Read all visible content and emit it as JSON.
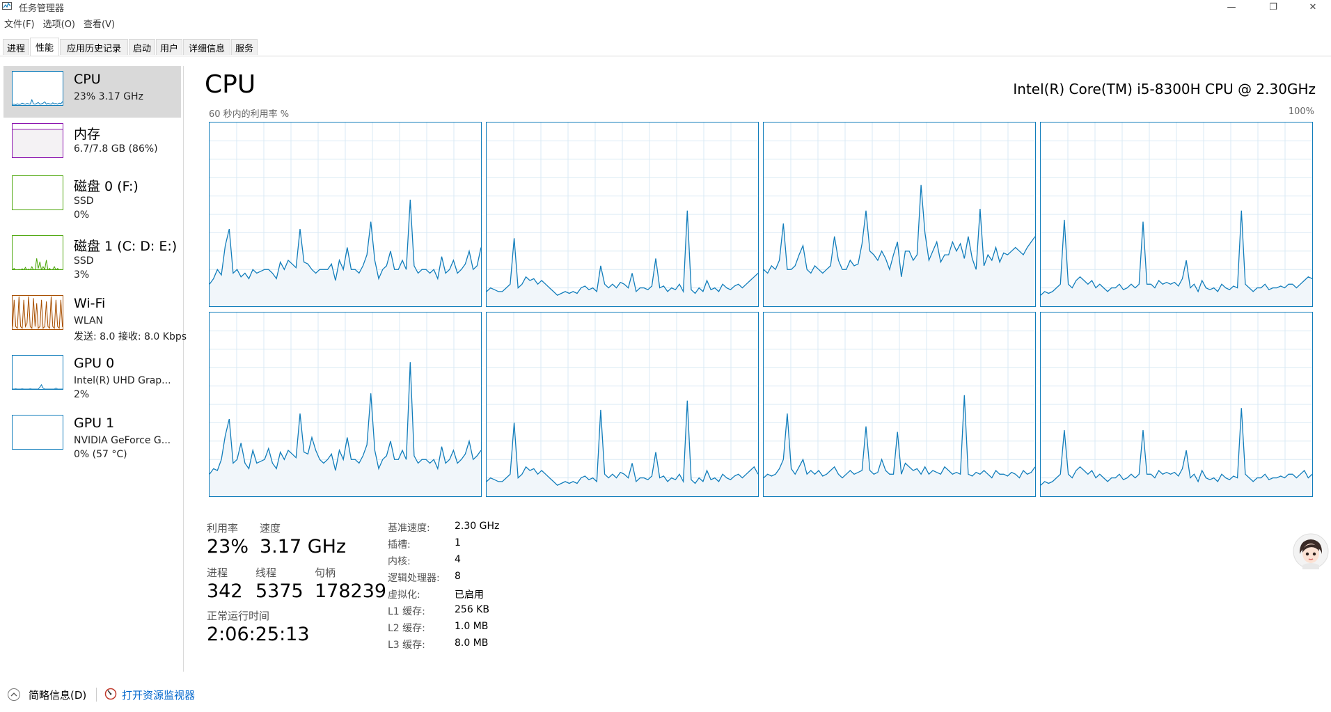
{
  "window": {
    "title": "任务管理器",
    "controls": {
      "minimize": "—",
      "maximize": "❐",
      "close": "✕"
    }
  },
  "menu": [
    "文件(F)",
    "选项(O)",
    "查看(V)"
  ],
  "tabs": [
    "进程",
    "性能",
    "应用历史记录",
    "启动",
    "用户",
    "详细信息",
    "服务"
  ],
  "active_tab": "性能",
  "sidebar": [
    {
      "title": "CPU",
      "line1": "23%  3.17 GHz",
      "line2": "",
      "color": "#117dbb",
      "fill": "#f1f6fa",
      "active": true,
      "graph": [
        0.04,
        0.05,
        0.03,
        0.06,
        0.04,
        0.05,
        0.08,
        0.06,
        0.05,
        0.07,
        0.06,
        0.05,
        0.18,
        0.06,
        0.05,
        0.07,
        0.1,
        0.05,
        0.06,
        0.08,
        0.12,
        0.05,
        0.07,
        0.06,
        0.05,
        0.09,
        0.06,
        0.07,
        0.05,
        0.08,
        0.06,
        0.12,
        0.05
      ]
    },
    {
      "title": "内存",
      "line1": "6.7/7.8 GB (86%)",
      "line2": "",
      "color": "#8b12ae",
      "fill": "#f4f2f4",
      "active": false,
      "graph": [
        0.86,
        0.86,
        0.86,
        0.86,
        0.86,
        0.86,
        0.86,
        0.86,
        0.86,
        0.86,
        0.86,
        0.86,
        0.86,
        0.86,
        0.86,
        0.86,
        0.86,
        0.86,
        0.86,
        0.86,
        0.86,
        0.86,
        0.86,
        0.86,
        0.86,
        0.86,
        0.86,
        0.86,
        0.86,
        0.86,
        0.86,
        0.86,
        0.86
      ]
    },
    {
      "title": "磁盘 0 (F:)",
      "line1": "SSD",
      "line2": "0%",
      "color": "#4da60c",
      "fill": "#eff7e9",
      "active": false,
      "graph": [
        0,
        0,
        0,
        0,
        0,
        0,
        0,
        0,
        0,
        0,
        0,
        0,
        0,
        0,
        0,
        0,
        0,
        0,
        0,
        0,
        0,
        0,
        0,
        0,
        0,
        0,
        0,
        0,
        0,
        0,
        0,
        0,
        0
      ]
    },
    {
      "title": "磁盘 1 (C: D: E:)",
      "line1": "SSD",
      "line2": "3%",
      "color": "#4da60c",
      "fill": "#eff7e9",
      "active": false,
      "graph": [
        0,
        0.05,
        0,
        0,
        0.02,
        0,
        0.04,
        0,
        0.08,
        0,
        0.03,
        0,
        0.1,
        0,
        0,
        0.35,
        0.05,
        0.25,
        0,
        0.1,
        0.02,
        0.3,
        0,
        0.05,
        0,
        0.02,
        0.1,
        0,
        0.05,
        0,
        0.02,
        0,
        0.03
      ]
    },
    {
      "title": "Wi-Fi",
      "line1": "WLAN",
      "line2": "发送: 8.0 接收: 8.0 Kbps",
      "color": "#a74f01",
      "fill": "#fcf3eb",
      "active": false,
      "graph": [
        0.1,
        0.9,
        0.1,
        0.05,
        1,
        0.1,
        0.05,
        0.9,
        0.1,
        0.2,
        1,
        0.1,
        0.05,
        0.95,
        0.1,
        0.8,
        0.05,
        0.1,
        0.9,
        0.05,
        0.1,
        0.85,
        0.1,
        0.05,
        1,
        0.1,
        0.05,
        0.9,
        0.1,
        0.05,
        0.9,
        0.1,
        0.05
      ]
    },
    {
      "title": "GPU 0",
      "line1": "Intel(R) UHD Grap...",
      "line2": "2%",
      "color": "#117dbb",
      "fill": "#f1f6fa",
      "active": false,
      "graph": [
        0.02,
        0.02,
        0.03,
        0.02,
        0.02,
        0.02,
        0.03,
        0.02,
        0.02,
        0.02,
        0.02,
        0.03,
        0.02,
        0.02,
        0.02,
        0.02,
        0.02,
        0.08,
        0.15,
        0.05,
        0.02,
        0.02,
        0.02,
        0.02,
        0.02,
        0.02,
        0.02,
        0.05,
        0.02,
        0.02,
        0.02,
        0.02,
        0.02
      ]
    },
    {
      "title": "GPU 1",
      "line1": "NVIDIA GeForce G...",
      "line2": "0% (57 °C)",
      "color": "#117dbb",
      "fill": "#f1f6fa",
      "active": false,
      "graph": [
        0,
        0,
        0,
        0,
        0,
        0,
        0,
        0,
        0,
        0,
        0,
        0,
        0,
        0,
        0,
        0,
        0,
        0,
        0,
        0,
        0,
        0,
        0,
        0,
        0,
        0,
        0,
        0,
        0,
        0,
        0,
        0,
        0
      ]
    }
  ],
  "main": {
    "title": "CPU",
    "model": "Intel(R) Core(TM) i5-8300H CPU @ 2.30GHz",
    "usage_label": "60 秒内的利用率 %",
    "usage_max": "100%",
    "graph_color": "#117dbb",
    "graph_fill": "#f1f6fa",
    "grid_color": "#d9eaf4",
    "cores": [
      [
        0.12,
        0.15,
        0.2,
        0.17,
        0.33,
        0.42,
        0.18,
        0.2,
        0.16,
        0.18,
        0.15,
        0.2,
        0.18,
        0.19,
        0.2,
        0.2,
        0.18,
        0.15,
        0.24,
        0.2,
        0.25,
        0.23,
        0.21,
        0.42,
        0.24,
        0.23,
        0.2,
        0.18,
        0.2,
        0.2,
        0.2,
        0.23,
        0.14,
        0.25,
        0.2,
        0.32,
        0.2,
        0.2,
        0.18,
        0.22,
        0.28,
        0.46,
        0.25,
        0.15,
        0.2,
        0.22,
        0.3,
        0.2,
        0.2,
        0.25,
        0.2,
        0.58,
        0.22,
        0.18,
        0.2,
        0.2,
        0.18,
        0.2,
        0.15,
        0.27,
        0.18,
        0.2,
        0.25,
        0.18,
        0.2,
        0.23,
        0.3,
        0.2,
        0.22,
        0.32
      ],
      [
        0.08,
        0.1,
        0.09,
        0.08,
        0.08,
        0.1,
        0.12,
        0.37,
        0.1,
        0.12,
        0.16,
        0.14,
        0.15,
        0.12,
        0.14,
        0.12,
        0.1,
        0.08,
        0.06,
        0.07,
        0.08,
        0.07,
        0.08,
        0.07,
        0.1,
        0.11,
        0.09,
        0.1,
        0.08,
        0.22,
        0.12,
        0.1,
        0.12,
        0.1,
        0.13,
        0.12,
        0.1,
        0.18,
        0.08,
        0.1,
        0.1,
        0.09,
        0.11,
        0.26,
        0.1,
        0.11,
        0.08,
        0.1,
        0.09,
        0.12,
        0.08,
        0.52,
        0.09,
        0.07,
        0.1,
        0.08,
        0.14,
        0.09,
        0.1,
        0.08,
        0.12,
        0.1,
        0.09,
        0.11,
        0.12,
        0.1,
        0.12,
        0.14,
        0.16,
        0.18
      ],
      [
        0.2,
        0.18,
        0.22,
        0.2,
        0.25,
        0.45,
        0.2,
        0.2,
        0.22,
        0.28,
        0.33,
        0.2,
        0.18,
        0.22,
        0.2,
        0.18,
        0.2,
        0.22,
        0.38,
        0.25,
        0.2,
        0.2,
        0.25,
        0.22,
        0.23,
        0.34,
        0.52,
        0.3,
        0.28,
        0.25,
        0.3,
        0.26,
        0.2,
        0.28,
        0.35,
        0.16,
        0.3,
        0.3,
        0.25,
        0.28,
        0.66,
        0.4,
        0.25,
        0.3,
        0.35,
        0.24,
        0.28,
        0.28,
        0.35,
        0.3,
        0.34,
        0.26,
        0.38,
        0.26,
        0.2,
        0.53,
        0.22,
        0.28,
        0.25,
        0.32,
        0.24,
        0.29,
        0.28,
        0.3,
        0.32,
        0.3,
        0.28,
        0.32,
        0.35,
        0.38
      ],
      [
        0.06,
        0.08,
        0.07,
        0.08,
        0.1,
        0.12,
        0.47,
        0.12,
        0.1,
        0.14,
        0.16,
        0.14,
        0.12,
        0.14,
        0.1,
        0.12,
        0.1,
        0.08,
        0.1,
        0.1,
        0.12,
        0.09,
        0.1,
        0.12,
        0.1,
        0.12,
        0.46,
        0.12,
        0.12,
        0.1,
        0.14,
        0.12,
        0.13,
        0.12,
        0.13,
        0.11,
        0.15,
        0.25,
        0.1,
        0.12,
        0.08,
        0.14,
        0.1,
        0.09,
        0.1,
        0.08,
        0.12,
        0.1,
        0.09,
        0.11,
        0.1,
        0.52,
        0.12,
        0.1,
        0.08,
        0.1,
        0.1,
        0.12,
        0.09,
        0.1,
        0.1,
        0.11,
        0.1,
        0.12,
        0.12,
        0.1,
        0.12,
        0.14,
        0.16,
        0.15
      ],
      [
        0.12,
        0.15,
        0.14,
        0.2,
        0.33,
        0.42,
        0.18,
        0.2,
        0.29,
        0.18,
        0.15,
        0.25,
        0.18,
        0.19,
        0.2,
        0.26,
        0.18,
        0.15,
        0.24,
        0.2,
        0.25,
        0.23,
        0.21,
        0.45,
        0.24,
        0.23,
        0.32,
        0.25,
        0.2,
        0.18,
        0.2,
        0.23,
        0.14,
        0.25,
        0.2,
        0.32,
        0.2,
        0.2,
        0.18,
        0.22,
        0.28,
        0.56,
        0.25,
        0.15,
        0.2,
        0.22,
        0.3,
        0.2,
        0.2,
        0.25,
        0.2,
        0.73,
        0.22,
        0.18,
        0.2,
        0.2,
        0.18,
        0.2,
        0.15,
        0.27,
        0.18,
        0.2,
        0.25,
        0.18,
        0.2,
        0.23,
        0.3,
        0.2,
        0.22,
        0.25
      ],
      [
        0.08,
        0.1,
        0.09,
        0.08,
        0.08,
        0.1,
        0.12,
        0.4,
        0.1,
        0.12,
        0.16,
        0.14,
        0.15,
        0.12,
        0.14,
        0.12,
        0.1,
        0.08,
        0.06,
        0.07,
        0.08,
        0.07,
        0.08,
        0.07,
        0.1,
        0.11,
        0.09,
        0.1,
        0.08,
        0.47,
        0.12,
        0.1,
        0.12,
        0.1,
        0.13,
        0.12,
        0.1,
        0.18,
        0.08,
        0.1,
        0.1,
        0.09,
        0.11,
        0.24,
        0.1,
        0.11,
        0.08,
        0.1,
        0.09,
        0.12,
        0.08,
        0.52,
        0.09,
        0.07,
        0.1,
        0.08,
        0.14,
        0.09,
        0.1,
        0.08,
        0.12,
        0.1,
        0.09,
        0.11,
        0.12,
        0.1,
        0.12,
        0.14,
        0.16,
        0.12
      ],
      [
        0.1,
        0.12,
        0.11,
        0.12,
        0.15,
        0.2,
        0.45,
        0.15,
        0.12,
        0.16,
        0.2,
        0.12,
        0.14,
        0.12,
        0.14,
        0.11,
        0.12,
        0.14,
        0.16,
        0.12,
        0.1,
        0.12,
        0.14,
        0.12,
        0.13,
        0.14,
        0.38,
        0.14,
        0.12,
        0.13,
        0.2,
        0.14,
        0.12,
        0.12,
        0.35,
        0.12,
        0.18,
        0.16,
        0.14,
        0.15,
        0.12,
        0.16,
        0.12,
        0.14,
        0.13,
        0.12,
        0.16,
        0.14,
        0.12,
        0.13,
        0.12,
        0.55,
        0.12,
        0.11,
        0.13,
        0.12,
        0.14,
        0.12,
        0.1,
        0.14,
        0.12,
        0.12,
        0.11,
        0.13,
        0.12,
        0.1,
        0.14,
        0.12,
        0.13,
        0.16
      ],
      [
        0.06,
        0.08,
        0.07,
        0.08,
        0.1,
        0.12,
        0.36,
        0.12,
        0.1,
        0.14,
        0.16,
        0.14,
        0.12,
        0.14,
        0.1,
        0.12,
        0.1,
        0.08,
        0.1,
        0.1,
        0.12,
        0.09,
        0.1,
        0.12,
        0.1,
        0.12,
        0.36,
        0.12,
        0.12,
        0.1,
        0.14,
        0.12,
        0.13,
        0.12,
        0.13,
        0.11,
        0.15,
        0.25,
        0.1,
        0.12,
        0.08,
        0.14,
        0.1,
        0.09,
        0.1,
        0.08,
        0.12,
        0.1,
        0.09,
        0.11,
        0.1,
        0.48,
        0.12,
        0.1,
        0.08,
        0.1,
        0.1,
        0.12,
        0.09,
        0.1,
        0.1,
        0.11,
        0.1,
        0.12,
        0.12,
        0.1,
        0.12,
        0.14,
        0.1,
        0.12
      ]
    ],
    "stats": {
      "util_label": "利用率",
      "util_value": "23%",
      "speed_label": "速度",
      "speed_value": "3.17 GHz",
      "proc_label": "进程",
      "proc_value": "342",
      "thread_label": "线程",
      "thread_value": "5375",
      "handle_label": "句柄",
      "handle_value": "178239",
      "uptime_label": "正常运行时间",
      "uptime_value": "2:06:25:13"
    },
    "details": [
      {
        "key": "基准速度:",
        "value": "2.30 GHz"
      },
      {
        "key": "插槽:",
        "value": "1"
      },
      {
        "key": "内核:",
        "value": "4"
      },
      {
        "key": "逻辑处理器:",
        "value": "8"
      },
      {
        "key": "虚拟化:",
        "value": "已启用"
      },
      {
        "key": "L1 缓存:",
        "value": "256 KB"
      },
      {
        "key": "L2 缓存:",
        "value": "1.0 MB"
      },
      {
        "key": "L3 缓存:",
        "value": "8.0 MB"
      }
    ]
  },
  "footer": {
    "brief": "简略信息(D)",
    "monitor_link": "打开资源监视器"
  },
  "icons": {
    "app": "task-manager-icon",
    "collapse": "chevron-up-icon",
    "monitor": "resource-monitor-icon",
    "assistant": "assistant-avatar-icon"
  }
}
